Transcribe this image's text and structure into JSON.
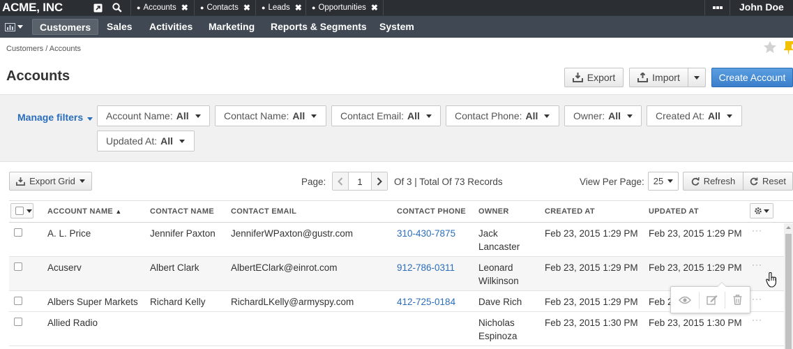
{
  "topbar": {
    "brand": "ACME, INC",
    "tabs": [
      {
        "label": "Accounts"
      },
      {
        "label": "Contacts"
      },
      {
        "label": "Leads"
      },
      {
        "label": "Opportunities"
      }
    ],
    "more_icon": "ellipsis-icon",
    "user": "John Doe"
  },
  "nav": {
    "items": [
      "Customers",
      "Sales",
      "Activities",
      "Marketing",
      "Reports & Segments",
      "System"
    ],
    "active": "Customers"
  },
  "breadcrumb": {
    "parent": "Customers",
    "separator": "/",
    "current": "Accounts"
  },
  "page": {
    "title": "Accounts",
    "export_label": "Export",
    "import_label": "Import",
    "create_label": "Create Account"
  },
  "filters": {
    "manage_label": "Manage filters",
    "items": [
      {
        "label": "Account Name:",
        "value": "All"
      },
      {
        "label": "Contact Name:",
        "value": "All"
      },
      {
        "label": "Contact Email:",
        "value": "All"
      },
      {
        "label": "Contact Phone:",
        "value": "All"
      },
      {
        "label": "Owner:",
        "value": "All"
      },
      {
        "label": "Created At:",
        "value": "All"
      },
      {
        "label": "Updated At:",
        "value": "All"
      }
    ]
  },
  "grid_toolbar": {
    "export_grid_label": "Export Grid",
    "page_label": "Page:",
    "page_value": "1",
    "page_info": "Of 3 | Total Of 73 Records",
    "per_page_label": "View Per Page:",
    "per_page_value": "25",
    "refresh_label": "Refresh",
    "reset_label": "Reset"
  },
  "grid": {
    "columns": [
      "ACCOUNT NAME",
      "CONTACT NAME",
      "CONTACT EMAIL",
      "CONTACT PHONE",
      "OWNER",
      "CREATED AT",
      "UPDATED AT"
    ],
    "sort_indicator": "▲",
    "rows": [
      {
        "account": "A. L. Price",
        "contact": "Jennifer Paxton",
        "email": "JenniferWPaxton@gustr.com",
        "phone": "310-430-7875",
        "owner1": "Jack",
        "owner2": "Lancaster",
        "created": "Feb 23, 2015 1:29 PM",
        "updated": "Feb 23, 2015 1:29 PM"
      },
      {
        "account": "Acuserv",
        "contact": "Albert Clark",
        "email": "AlbertEClark@einrot.com",
        "phone": "912-786-0311",
        "owner1": "Leonard",
        "owner2": "Wilkinson",
        "created": "Feb 23, 2015 1:29 PM",
        "updated": "Feb 23, 2015 1:29 PM"
      },
      {
        "account": "Albers Super Markets",
        "contact": "Richard Kelly",
        "email": "RichardLKelly@armyspy.com",
        "phone": "412-725-0184",
        "owner1": "Dave Rich",
        "owner2": "",
        "created": "Feb 23, 2015 1:29 PM",
        "updated": "Feb 2"
      },
      {
        "account": "Allied Radio",
        "contact": "",
        "email": "",
        "phone": "",
        "owner1": "Nicholas",
        "owner2": "Espinoza",
        "created": "Feb 23, 2015 1:30 PM",
        "updated": "Feb 23, 2015 1:30 PM"
      }
    ],
    "row_action_label": "···"
  },
  "colors": {
    "topbar": "#2b2e33",
    "navbar": "#404953",
    "link": "#2a6ebb",
    "primary": "#3b7fcb"
  }
}
